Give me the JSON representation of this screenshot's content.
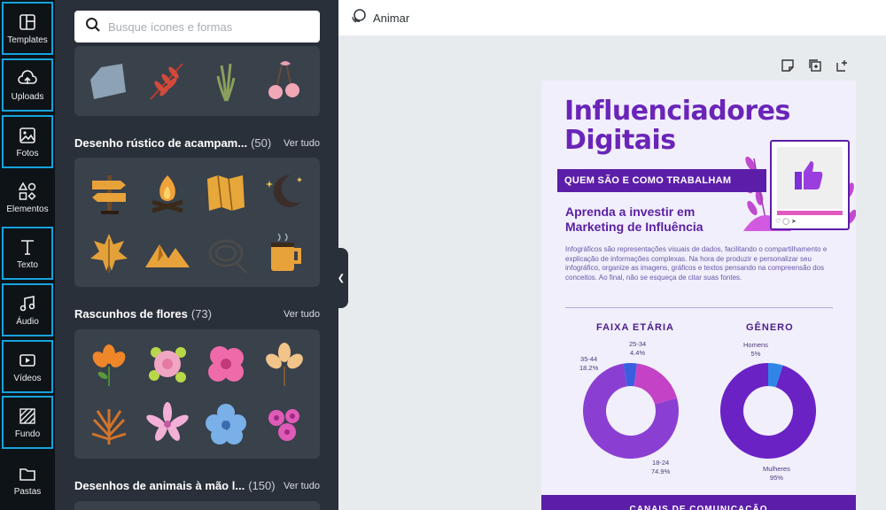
{
  "sidebar": {
    "items": [
      {
        "label": "Templates",
        "icon": "layout-icon",
        "highlighted": true
      },
      {
        "label": "Uploads",
        "icon": "cloud-upload-icon",
        "highlighted": true
      },
      {
        "label": "Fotos",
        "icon": "image-icon",
        "highlighted": true
      },
      {
        "label": "Elementos",
        "icon": "shapes-icon",
        "highlighted": false
      },
      {
        "label": "Texto",
        "icon": "text-icon",
        "highlighted": true
      },
      {
        "label": "Áudio",
        "icon": "music-icon",
        "highlighted": true
      },
      {
        "label": "Vídeos",
        "icon": "video-icon",
        "highlighted": true
      },
      {
        "label": "Fundo",
        "icon": "background-icon",
        "highlighted": true
      },
      {
        "label": "Pastas",
        "icon": "folder-icon",
        "highlighted": false
      }
    ],
    "highlight_color": "#16a3dc"
  },
  "panel": {
    "search_placeholder": "Busque ícones e formas",
    "see_all": "Ver tudo",
    "sections": [
      {
        "title": "Desenho rústico de acampam...",
        "count": "(50)"
      },
      {
        "title": "Rascunhos de flores",
        "count": "(73)"
      },
      {
        "title": "Desenhos de animais à mão l...",
        "count": "(150)"
      }
    ]
  },
  "topbar": {
    "animate_label": "Animar",
    "icon": "animate-icon"
  },
  "design": {
    "title_line1": "Influenciadores",
    "title_line2": "Digitais",
    "ribbon": "QUEM SÃO E COMO TRABALHAM",
    "subtitle": "Aprenda a investir em Marketing de Influência",
    "body": "Infográficos são representações visuais de dados, facilitando o compartilhamento e explicação de informações complexas. Na hora de produzir e personalizar seu infográfico, organize as imagens, gráficos e textos pensando na compreensão dos conceitos. Ao final, não se esqueça de citar suas fontes.",
    "footer": "CANAIS DE COMUNICAÇÃO",
    "accent": "#6a25b8"
  },
  "chart_data": [
    {
      "type": "pie",
      "title": "FAIXA ETÁRIA",
      "categories": [
        "18-24",
        "25-34",
        "35-44"
      ],
      "values": [
        74.9,
        4.4,
        18.2
      ],
      "labels": [
        "74.9%",
        "4.4%",
        "18.2%"
      ]
    },
    {
      "type": "pie",
      "title": "GÊNERO",
      "categories": [
        "Mulheres",
        "Homens"
      ],
      "values": [
        95,
        5
      ],
      "labels": [
        "95%",
        "5%"
      ]
    }
  ]
}
